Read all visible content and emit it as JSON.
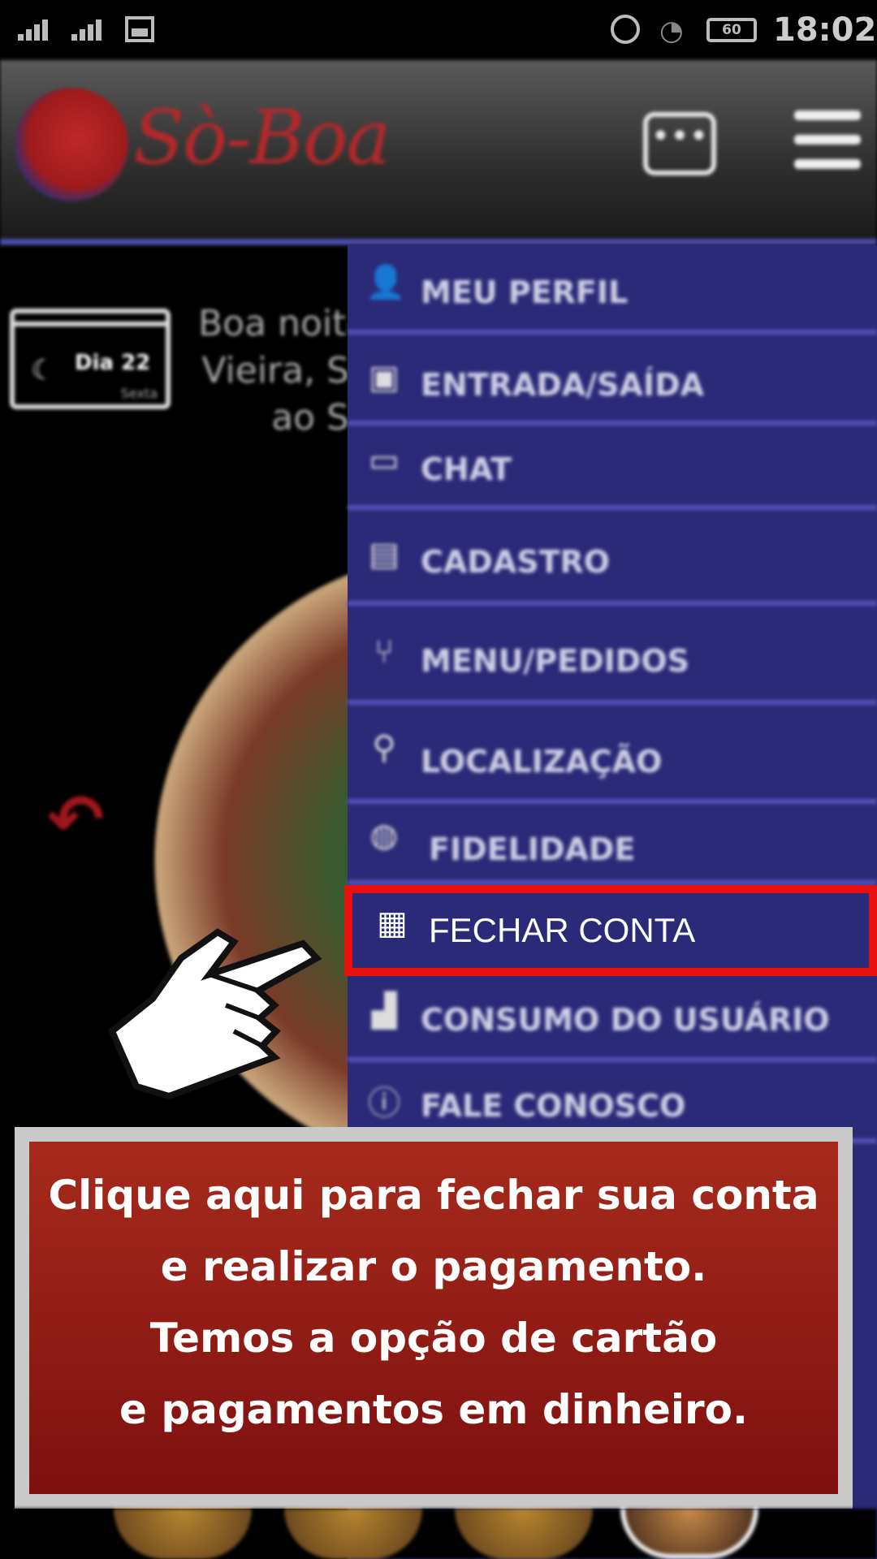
{
  "status_bar": {
    "time": "18:02",
    "battery": "60",
    "icons": [
      "signal-icon",
      "signal-icon",
      "photo-icon",
      "alarm-icon",
      "wifi-icon",
      "battery-icon"
    ]
  },
  "header": {
    "logo_text": "Sò-Boa",
    "chat_icon": "chat-bubble-icon",
    "menu_icon": "hamburger-icon"
  },
  "background": {
    "calendar": {
      "day_label": "Dia 22",
      "weekday": "Sexta"
    },
    "greeting_lines": [
      "Boa noite",
      "Vieira, S",
      "ao S"
    ]
  },
  "menu": {
    "items": [
      {
        "label": "MEU PERFIL",
        "icon": "person-icon"
      },
      {
        "label": "ENTRADA/SAÍDA",
        "icon": "door-icon"
      },
      {
        "label": "CHAT",
        "icon": "chat-icon"
      },
      {
        "label": "CADASTRO",
        "icon": "document-icon"
      },
      {
        "label": "MENU/PEDIDOS",
        "icon": "cutlery-icon"
      },
      {
        "label": "LOCALIZAÇÃO",
        "icon": "location-pin-icon"
      },
      {
        "label": "FIDELIDADE",
        "icon": "loyalty-icon"
      },
      {
        "label": "FECHAR CONTA",
        "icon": "cash-register-icon",
        "highlighted": true
      },
      {
        "label": "CONSUMO DO USUÁRIO",
        "icon": "chart-icon"
      },
      {
        "label": "FALE CONOSCO",
        "icon": "help-icon"
      }
    ]
  },
  "callout": {
    "lines": [
      "Clique aqui para fechar sua conta",
      "e realizar o pagamento.",
      "Temos a opção de cartão",
      "e pagamentos em dinheiro."
    ]
  },
  "colors": {
    "drawer": "#2b2a78",
    "divider": "#5454b8",
    "highlight_border": "#ea1010",
    "callout_bg": "#9a1f14",
    "brand": "#b2282a"
  }
}
